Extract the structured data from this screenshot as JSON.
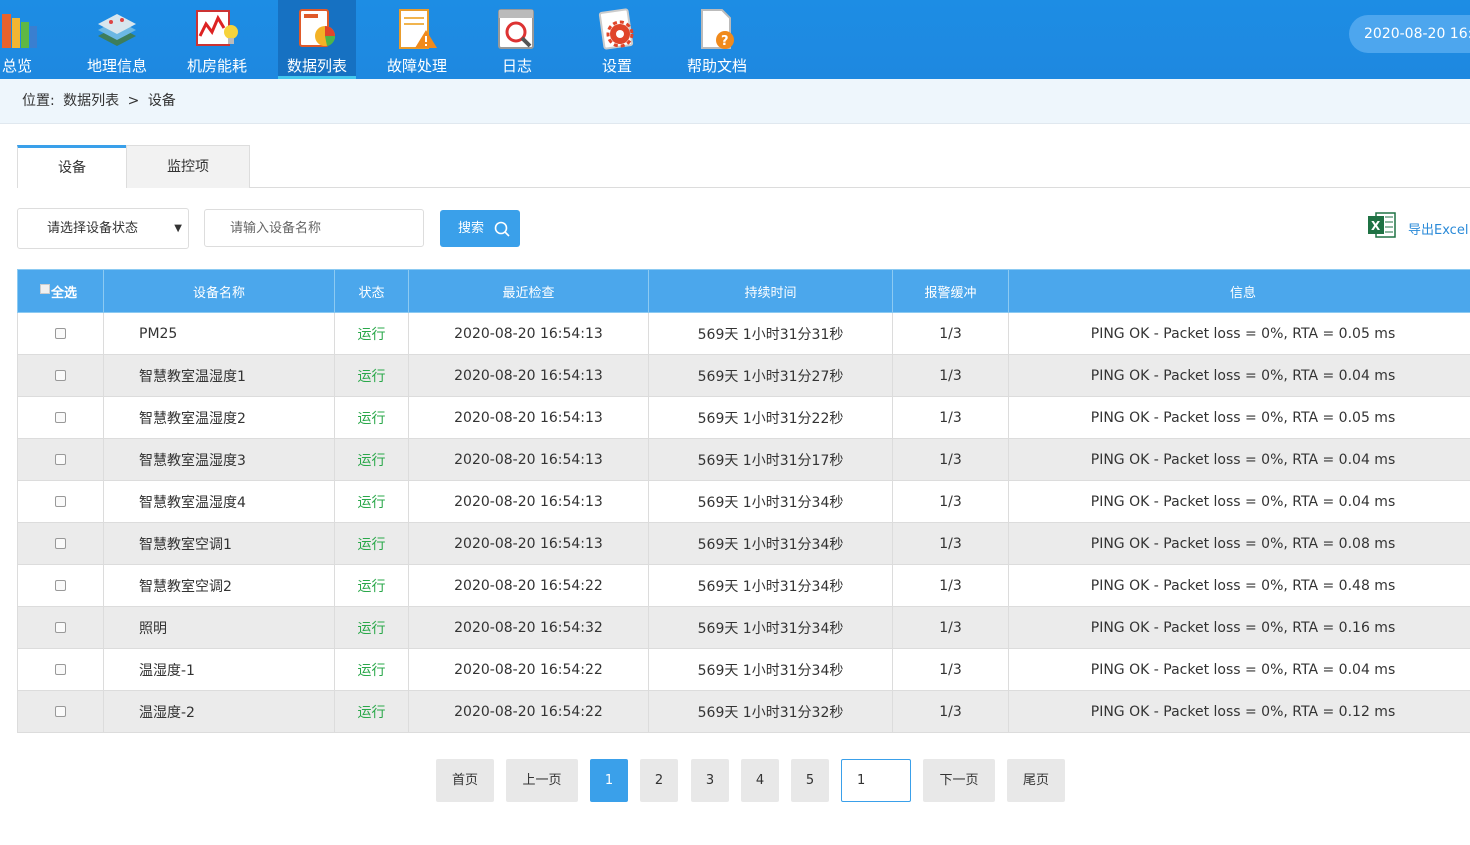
{
  "nav": {
    "items": [
      {
        "label": "总览",
        "icon": "books-icon"
      },
      {
        "label": "地理信息",
        "icon": "map-layers-icon"
      },
      {
        "label": "机房能耗",
        "icon": "energy-chart-bulb-icon"
      },
      {
        "label": "数据列表",
        "icon": "data-report-icon",
        "active": true
      },
      {
        "label": "故障处理",
        "icon": "warning-document-icon"
      },
      {
        "label": "日志",
        "icon": "calendar-search-icon"
      },
      {
        "label": "设置",
        "icon": "gear-document-icon"
      },
      {
        "label": "帮助文档",
        "icon": "help-document-icon"
      }
    ],
    "datetime": "2020-08-20  16:"
  },
  "breadcrumb": {
    "prefix": "位置:",
    "section": "数据列表",
    "sep": ">",
    "page": "设备"
  },
  "tabs": [
    {
      "label": "设备",
      "active": true
    },
    {
      "label": "监控项",
      "active": false
    }
  ],
  "filters": {
    "status_select": "请选择设备状态",
    "name_placeholder": "请输入设备名称",
    "search_label": "搜索",
    "export_label": "导出Excel"
  },
  "table": {
    "headers": {
      "select_all": "全选",
      "name": "设备名称",
      "status": "状态",
      "last_check": "最近检查",
      "duration": "持续时间",
      "alert_buffer": "报警缓冲",
      "info": "信息"
    },
    "rows": [
      {
        "name": "PM25",
        "status": "运行",
        "last_check": "2020-08-20 16:54:13",
        "duration": "569天 1小时31分31秒",
        "buffer": "1/3",
        "info": "PING OK - Packet loss = 0%, RTA = 0.05 ms"
      },
      {
        "name": "智慧教室温湿度1",
        "status": "运行",
        "last_check": "2020-08-20 16:54:13",
        "duration": "569天 1小时31分27秒",
        "buffer": "1/3",
        "info": "PING OK - Packet loss = 0%, RTA = 0.04 ms"
      },
      {
        "name": "智慧教室温湿度2",
        "status": "运行",
        "last_check": "2020-08-20 16:54:13",
        "duration": "569天 1小时31分22秒",
        "buffer": "1/3",
        "info": "PING OK - Packet loss = 0%, RTA = 0.05 ms"
      },
      {
        "name": "智慧教室温湿度3",
        "status": "运行",
        "last_check": "2020-08-20 16:54:13",
        "duration": "569天 1小时31分17秒",
        "buffer": "1/3",
        "info": "PING OK - Packet loss = 0%, RTA = 0.04 ms"
      },
      {
        "name": "智慧教室温湿度4",
        "status": "运行",
        "last_check": "2020-08-20 16:54:13",
        "duration": "569天 1小时31分34秒",
        "buffer": "1/3",
        "info": "PING OK - Packet loss = 0%, RTA = 0.04 ms"
      },
      {
        "name": "智慧教室空调1",
        "status": "运行",
        "last_check": "2020-08-20 16:54:13",
        "duration": "569天 1小时31分34秒",
        "buffer": "1/3",
        "info": "PING OK - Packet loss = 0%, RTA = 0.08 ms"
      },
      {
        "name": "智慧教室空调2",
        "status": "运行",
        "last_check": "2020-08-20 16:54:22",
        "duration": "569天 1小时31分34秒",
        "buffer": "1/3",
        "info": "PING OK - Packet loss = 0%, RTA = 0.48 ms"
      },
      {
        "name": "照明",
        "status": "运行",
        "last_check": "2020-08-20 16:54:32",
        "duration": "569天 1小时31分34秒",
        "buffer": "1/3",
        "info": "PING OK - Packet loss = 0%, RTA = 0.16 ms"
      },
      {
        "name": "温湿度-1",
        "status": "运行",
        "last_check": "2020-08-20 16:54:22",
        "duration": "569天 1小时31分34秒",
        "buffer": "1/3",
        "info": "PING OK - Packet loss = 0%, RTA = 0.04 ms"
      },
      {
        "name": "温湿度-2",
        "status": "运行",
        "last_check": "2020-08-20 16:54:22",
        "duration": "569天 1小时31分32秒",
        "buffer": "1/3",
        "info": "PING OK - Packet loss = 0%, RTA = 0.12 ms"
      }
    ]
  },
  "pagination": {
    "first": "首页",
    "prev": "上一页",
    "pages": [
      "1",
      "2",
      "3",
      "4",
      "5"
    ],
    "current": "1",
    "jump_value": "1",
    "next": "下一页",
    "last": "尾页"
  },
  "colors": {
    "header_blue": "#1e88e0",
    "accent": "#3aa0ea",
    "status_green": "#2aa84a"
  }
}
